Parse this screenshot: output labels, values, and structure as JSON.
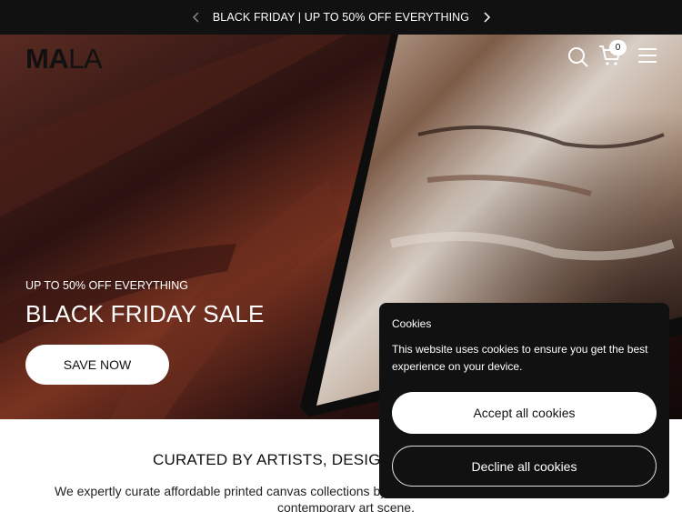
{
  "announcement": {
    "text": "BLACK FRIDAY | UP TO 50% OFF EVERYTHING"
  },
  "header": {
    "logo_bold": "MA",
    "logo_thin": "LA",
    "cart_count": "0"
  },
  "hero": {
    "kicker": "UP TO 50% OFF EVERYTHING",
    "title": "BLACK FRIDAY SALE",
    "button": "SAVE NOW"
  },
  "section": {
    "title": "CURATED BY ARTISTS, DESIGN",
    "body_line1": "We expertly curate affordable printed canvas collections by som",
    "body_line2": "contemporary art scene."
  },
  "cookie": {
    "title": "Cookies",
    "text": "This website uses cookies to ensure you get the best experience on your device.",
    "accept": "Accept all cookies",
    "decline": "Decline all cookies"
  },
  "icons": {
    "prev": "chevron-left-icon",
    "next": "chevron-right-icon",
    "search": "search-icon",
    "cart": "cart-icon",
    "menu": "menu-icon"
  }
}
